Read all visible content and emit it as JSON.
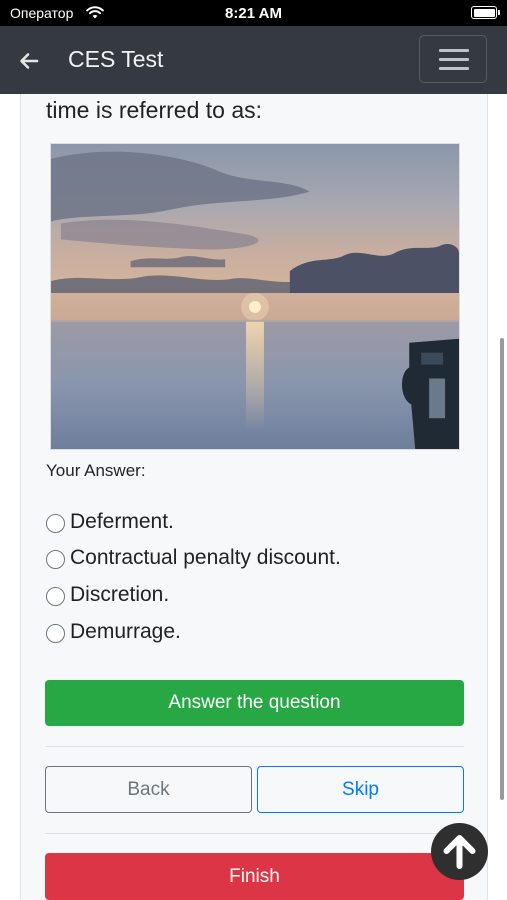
{
  "status_bar": {
    "carrier": "Оператор",
    "time": "8:21 AM"
  },
  "navbar": {
    "title": "CES Test",
    "back_icon": "arrow-left-icon",
    "menu_icon": "hamburger-menu-icon"
  },
  "question": {
    "text_fragment": "time is referred to as:",
    "image": "sunset-over-sea-photo"
  },
  "answer_label": "Your Answer:",
  "options": [
    {
      "label": "Deferment.",
      "selected": false
    },
    {
      "label": "Contractual penalty discount.",
      "selected": false
    },
    {
      "label": "Discretion.",
      "selected": false
    },
    {
      "label": "Demurrage.",
      "selected": false
    }
  ],
  "buttons": {
    "answer": "Answer the question",
    "back": "Back",
    "skip": "Skip",
    "finish": "Finish"
  },
  "colors": {
    "navbar": "#343a40",
    "success": "#28a745",
    "primary": "#007bff",
    "danger": "#dc3545",
    "secondary": "#6c757d"
  },
  "scroll_top_icon": "arrow-up-circle-icon"
}
